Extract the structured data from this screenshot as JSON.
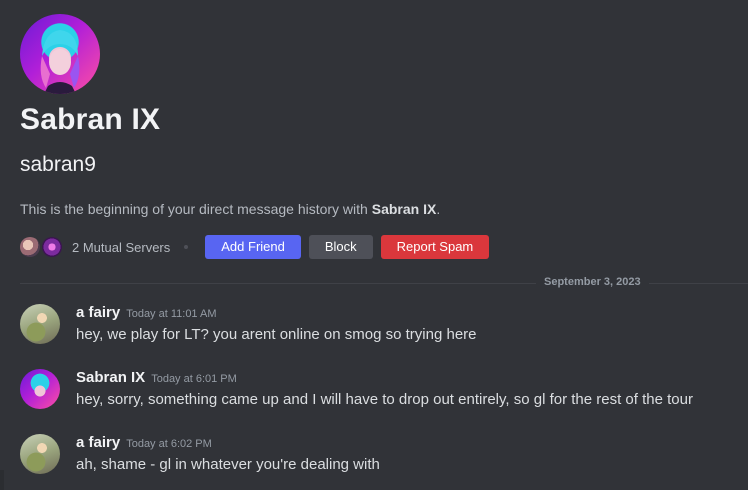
{
  "profile": {
    "display_name": "Sabran IX",
    "username": "sabran9",
    "intro_prefix": "This is the beginning of your direct message history with ",
    "intro_name": "Sabran IX",
    "intro_suffix": "."
  },
  "actions": {
    "mutual_servers": "2 Mutual Servers",
    "add_friend": "Add Friend",
    "block": "Block",
    "report_spam": "Report Spam"
  },
  "date_divider": "September 3, 2023",
  "messages": [
    {
      "author": "a fairy",
      "time": "Today at 11:01 AM",
      "text": "hey, we play for LT? you arent online on smog so trying here"
    },
    {
      "author": "Sabran IX",
      "time": "Today at 6:01 PM",
      "text": "hey, sorry, something came up and I will have to drop out entirely, so gl for the rest of the tour"
    },
    {
      "author": "a fairy",
      "time": "Today at 6:02 PM",
      "text": "ah, shame - gl in whatever you're dealing with"
    }
  ],
  "colors": {
    "background": "#313338",
    "add_friend": "#5865f2",
    "block": "#4e5058",
    "report_spam": "#da373c"
  }
}
